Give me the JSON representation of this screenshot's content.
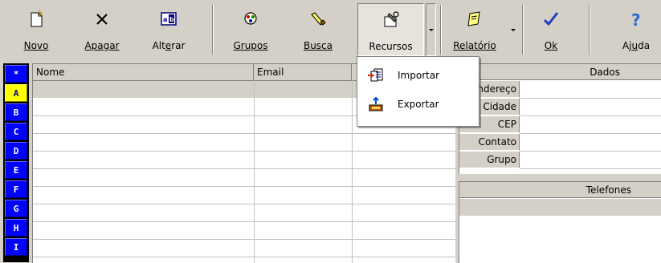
{
  "toolbar": {
    "buttons": [
      {
        "label": "Novo",
        "underline_index": 0,
        "icon": "new-document-icon"
      },
      {
        "label": "Apagar",
        "underline_index": 0,
        "icon": "delete-x-icon"
      },
      {
        "label": "Alterar",
        "underline_index": 3,
        "icon": "edit-ab-icon"
      },
      {
        "label": "Grupos",
        "underline_index": 0,
        "icon": "groups-icon"
      },
      {
        "label": "Busca",
        "underline_index": 0,
        "icon": "flashlight-icon"
      },
      {
        "label": "Recursos",
        "underline_index": -1,
        "icon": "tools-icon",
        "pressed": true
      },
      {
        "label": "Relatório",
        "underline_index": 0,
        "icon": "report-icon"
      },
      {
        "label": "Ok",
        "underline_index": 0,
        "icon": "checkmark-icon"
      },
      {
        "label": "Ajuda",
        "underline_index": 2,
        "icon": "help-icon"
      }
    ]
  },
  "index": {
    "items": [
      "*",
      "A",
      "B",
      "C",
      "D",
      "E",
      "F",
      "G",
      "H",
      "I"
    ],
    "active": "A"
  },
  "grid": {
    "columns": [
      "Nome",
      "Email",
      ""
    ],
    "rows": []
  },
  "dados": {
    "title": "Dados",
    "fields": [
      {
        "label": "Endereço",
        "value": ""
      },
      {
        "label": "Cidade",
        "value": ""
      },
      {
        "label": "CEP",
        "value": ""
      },
      {
        "label": "Contato",
        "value": ""
      },
      {
        "label": "Grupo",
        "value": ""
      }
    ]
  },
  "telefones": {
    "title": "Telefones"
  },
  "menu": {
    "items": [
      {
        "label": "Importar",
        "icon": "import-icon"
      },
      {
        "label": "Exportar",
        "icon": "export-icon"
      }
    ]
  },
  "colors": {
    "face": "#d4d0c8",
    "index_blue": "#0000ff",
    "index_active": "#ffff00",
    "ok_check": "#1f3fbf",
    "help": "#2a6ad0"
  }
}
